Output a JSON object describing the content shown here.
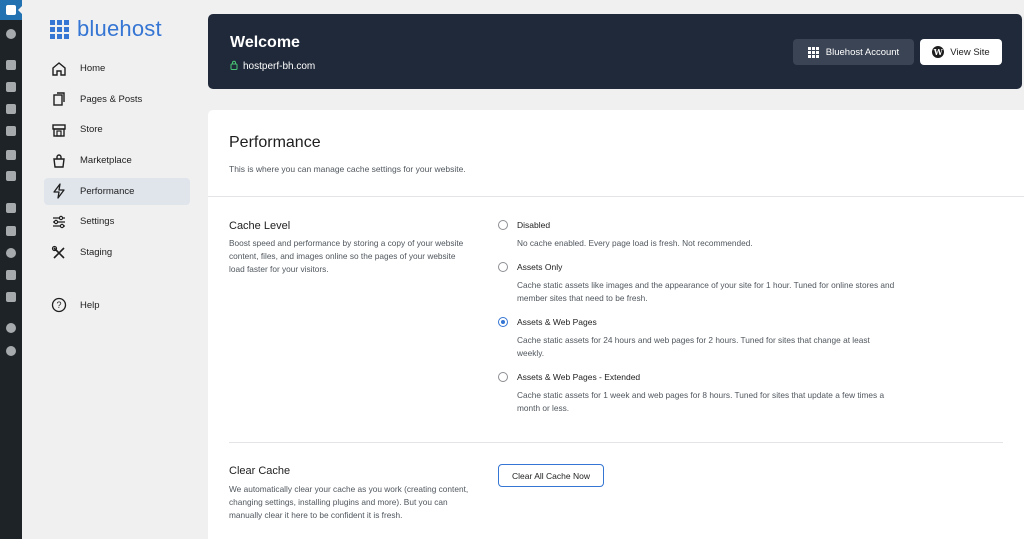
{
  "wp_rail": {
    "icons": [
      "dashboard-grid-icon",
      "speedometer-icon",
      "pin-icon",
      "media-icon",
      "pages-icon",
      "comments-icon",
      "mail-icon",
      "chart-icon",
      "brush-icon",
      "plugins-icon",
      "users-icon",
      "tools-icon",
      "settings-icon",
      "gear-badge-icon",
      "play-icon"
    ]
  },
  "brand": {
    "name": "bluehost",
    "color": "#3575d3"
  },
  "nav": {
    "items": [
      {
        "label": "Home",
        "icon": "home-icon"
      },
      {
        "label": "Pages & Posts",
        "icon": "pages-icon"
      },
      {
        "label": "Store",
        "icon": "store-icon"
      },
      {
        "label": "Marketplace",
        "icon": "bag-icon"
      },
      {
        "label": "Performance",
        "icon": "bolt-icon"
      },
      {
        "label": "Settings",
        "icon": "sliders-icon"
      },
      {
        "label": "Staging",
        "icon": "tools-icon"
      }
    ],
    "active": "Performance",
    "help_label": "Help"
  },
  "welcome": {
    "title": "Welcome",
    "site": "hostperf-bh.com",
    "account_button": "Bluehost Account",
    "view_button": "View Site"
  },
  "performance": {
    "title": "Performance",
    "description": "This is where you can manage cache settings for your website."
  },
  "cache_level": {
    "title": "Cache Level",
    "description": "Boost speed and performance by storing a copy of your website content, files, and images online so the pages of your website load faster for your visitors.",
    "options": [
      {
        "label": "Disabled",
        "description": "No cache enabled. Every page load is fresh. Not recommended.",
        "checked": false
      },
      {
        "label": "Assets Only",
        "description": "Cache static assets like images and the appearance of your site for 1 hour. Tuned for online stores and member sites that need to be fresh.",
        "checked": false
      },
      {
        "label": "Assets & Web Pages",
        "description": "Cache static assets for 24 hours and web pages for 2 hours. Tuned for sites that change at least weekly.",
        "checked": true
      },
      {
        "label": "Assets & Web Pages - Extended",
        "description": "Cache static assets for 1 week and web pages for 8 hours. Tuned for sites that update a few times a month or less.",
        "checked": false
      }
    ]
  },
  "clear_cache": {
    "title": "Clear Cache",
    "description": "We automatically clear your cache as you work (creating content, changing settings, installing plugins and more). But you can manually clear it here to be confident it is fresh.",
    "button": "Clear All Cache Now"
  }
}
